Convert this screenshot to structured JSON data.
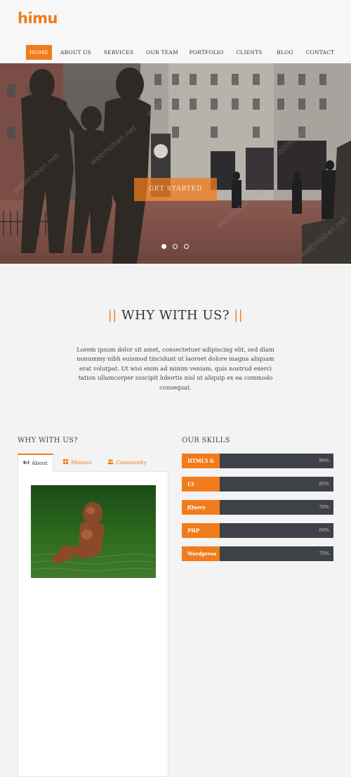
{
  "brand": {
    "logo": "himu",
    "accent": "#f07c1b"
  },
  "nav": {
    "items": [
      {
        "label": "HOME",
        "active": true
      },
      {
        "label": "ABOUT US",
        "active": false
      },
      {
        "label": "SERVICES",
        "active": false
      },
      {
        "label": "OUR TEAM",
        "active": false
      },
      {
        "label": "PORTFOLIO",
        "active": false
      },
      {
        "label": "CLIENTS",
        "active": false
      },
      {
        "label": "BLOG",
        "active": false
      },
      {
        "label": "CONTACT",
        "active": false
      }
    ]
  },
  "hero": {
    "cta_label": "GET STARTED",
    "slides": [
      {
        "active": true
      },
      {
        "active": false
      },
      {
        "active": false
      }
    ],
    "watermarks": [
      "webmoban.net",
      "webmoban.net",
      "webmoban.net",
      "webmoban.net",
      "webmoban.net",
      "webmoban.net"
    ]
  },
  "why": {
    "bar_left": "||",
    "title": "WHY WITH US?",
    "bar_right": "||",
    "text": "Lorem ipsum dolor sit amet, consectetuer adipiscing elit, sed diam nonummy nibh euismod tincidunt ut laoreet dolore magna aliquam erat volutpat. Ut wisi enim ad minim veniam, quis nostrud exerci tation ullamcorper suscipit lobortis nisl ut aliquip ex ea commodo consequat."
  },
  "tabs_section": {
    "title": "WHY WITH US?",
    "tabs": [
      {
        "label": "About",
        "icon": "link-icon",
        "active": true
      },
      {
        "label": "Mission",
        "icon": "grid-icon",
        "active": false
      },
      {
        "label": "Community",
        "icon": "users-icon",
        "active": false
      }
    ],
    "image_icon": "statue-photo"
  },
  "skills_section": {
    "title": "OUR SKILLS",
    "skills": [
      {
        "name": "HTML5 &",
        "percent_label": "90%",
        "level": 90
      },
      {
        "name": "UI",
        "percent_label": "85%",
        "level": 85
      },
      {
        "name": "jQuery",
        "percent_label": "70%",
        "level": 70
      },
      {
        "name": "PHP",
        "percent_label": "60%",
        "level": 60
      },
      {
        "name": "Wordpress",
        "percent_label": "75%",
        "level": 75
      }
    ]
  }
}
